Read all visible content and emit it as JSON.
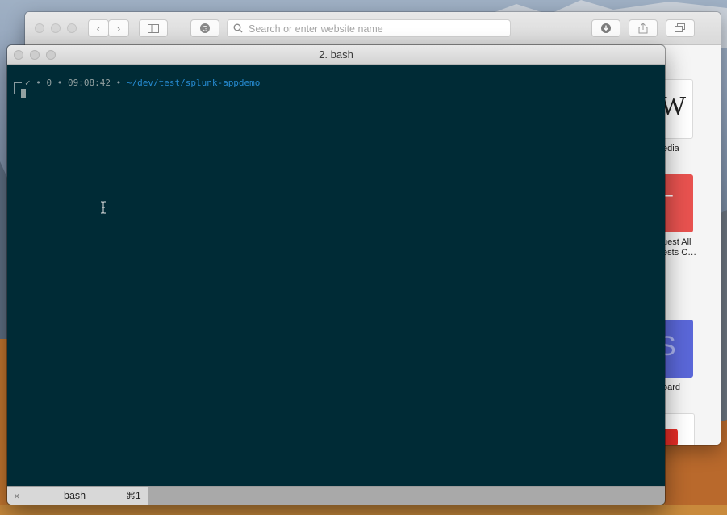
{
  "safari": {
    "search_placeholder": "Search or enter website name",
    "back_icon": "chevron-left-icon",
    "forward_icon": "chevron-right-icon",
    "sidebar_icon": "sidebar-icon",
    "reader_icon": "grammarly-icon",
    "downloads_icon": "download-icon",
    "share_icon": "share-icon",
    "tabs_icon": "tabs-overview-icon",
    "new_tab_label": "+",
    "favorites": [
      {
        "label": "edia",
        "letter": "W",
        "color": "#ffffff"
      },
      {
        "label": "uest All\nests C…",
        "letter": "–",
        "color": "#e8524f"
      },
      {
        "label": "oard",
        "letter": "S",
        "color": "#5a67d8"
      },
      {
        "label": "",
        "letter": "",
        "color": "#ffffff"
      }
    ]
  },
  "terminal": {
    "window_title": "2. bash",
    "prompt": {
      "status": "✓",
      "sep1": " • ",
      "exit_code": "0",
      "sep2": " • ",
      "time": "09:08:42",
      "sep3": " • ",
      "path": "~/dev/test/splunk-appdemo"
    },
    "tabs": [
      {
        "close": "×",
        "name": "bash",
        "shortcut": "⌘1"
      }
    ]
  },
  "colors": {
    "terminal_bg": "#002b36",
    "path_blue": "#268bd2",
    "prompt_grey": "#93a1a1"
  }
}
